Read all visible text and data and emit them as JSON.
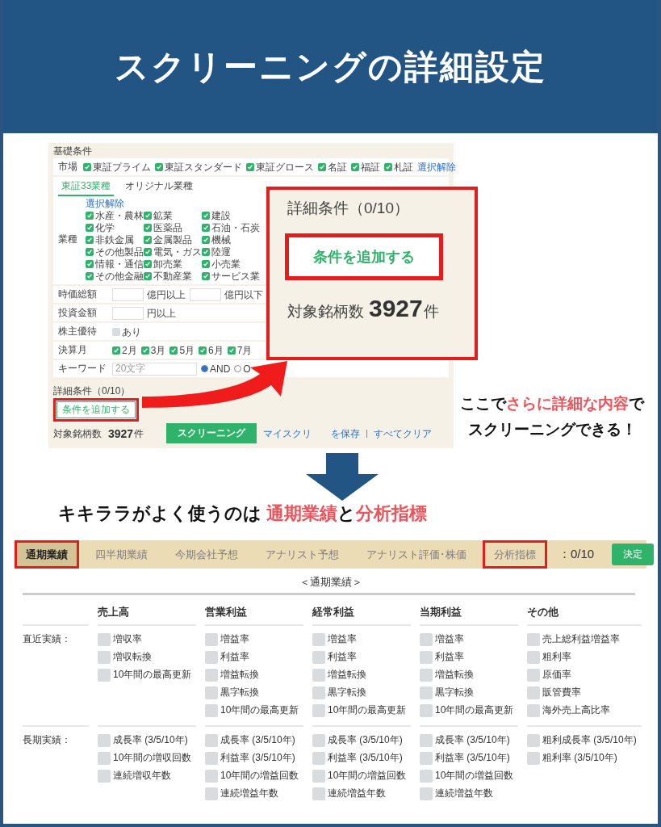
{
  "header": {
    "title": "スクリーニングの詳細設定"
  },
  "mini_screen": {
    "section_label": "基礎条件",
    "market": {
      "label": "市場",
      "options": [
        {
          "label": "東証プライム",
          "checked": true
        },
        {
          "label": "東証スタンダード",
          "checked": true
        },
        {
          "label": "東証グロース",
          "checked": true
        },
        {
          "label": "名証",
          "checked": true
        },
        {
          "label": "福証",
          "checked": true
        },
        {
          "label": "札証",
          "checked": true
        }
      ],
      "clear_link": "選択解除"
    },
    "industry_tabs": [
      {
        "label": "東証33業種",
        "selected": true
      },
      {
        "label": "オリジナル業種",
        "selected": false
      }
    ],
    "industry": {
      "label": "業種",
      "clear_link": "選択解除",
      "options": [
        {
          "label": "水産・農林",
          "checked": true
        },
        {
          "label": "鉱業",
          "checked": true
        },
        {
          "label": "建設",
          "checked": true
        },
        {
          "label": "化学",
          "checked": true
        },
        {
          "label": "医薬品",
          "checked": true
        },
        {
          "label": "石油・石炭",
          "checked": true
        },
        {
          "label": "非鉄金属",
          "checked": true
        },
        {
          "label": "金属製品",
          "checked": true
        },
        {
          "label": "機械",
          "checked": true
        },
        {
          "label": "その他製品",
          "checked": true
        },
        {
          "label": "電気・ガス",
          "checked": true
        },
        {
          "label": "陸運",
          "checked": true
        },
        {
          "label": "情報・通信",
          "checked": true
        },
        {
          "label": "卸売業",
          "checked": true
        },
        {
          "label": "小売業",
          "checked": true
        },
        {
          "label": "その他金融",
          "checked": true
        },
        {
          "label": "不動産業",
          "checked": true
        },
        {
          "label": "サービス業",
          "checked": true
        }
      ]
    },
    "fields": [
      {
        "kind": "range",
        "label": "時価総額",
        "units": [
          "億円以上",
          "億円以下"
        ]
      },
      {
        "kind": "range",
        "label": "投資金額",
        "units": [
          "円以上"
        ]
      },
      {
        "kind": "check",
        "label": "株主優待",
        "options": [
          {
            "label": "あり",
            "checked": false
          }
        ]
      },
      {
        "kind": "check",
        "label": "決算月",
        "options": [
          {
            "label": "2月",
            "checked": true
          },
          {
            "label": "3月",
            "checked": true
          },
          {
            "label": "5月",
            "checked": true
          },
          {
            "label": "6月",
            "checked": true
          },
          {
            "label": "7月",
            "checked": true
          }
        ]
      },
      {
        "kind": "keyword",
        "label": "キーワード",
        "placeholder": "20文字",
        "radios": [
          {
            "label": "AND",
            "selected": true
          },
          {
            "label": "O",
            "selected": false
          }
        ]
      }
    ],
    "detail_label": "詳細条件（0/10）",
    "add_button": {
      "label": "条件を追加する",
      "highlighted": true
    },
    "count": {
      "label": "対象銘柄数",
      "value": "3927",
      "unit": "件"
    },
    "screen_button": "スクリーニング",
    "links": [
      "マイスクリ",
      "を保存",
      "すべてクリア"
    ]
  },
  "callout": {
    "title": "詳細条件（0/10）",
    "button": {
      "label": "条件を追加する",
      "highlighted": true
    },
    "count_label": "対象銘柄数",
    "count": "3927",
    "unit": "件"
  },
  "note": [
    "ここで**さらに詳細な内容**で",
    "スクリーニングできる！"
  ],
  "caption": "キキララがよく使うのは **通期業績**と**分析指標**",
  "filter_tabs": [
    {
      "label": "通期業績",
      "selected": true,
      "highlighted": true
    },
    {
      "label": "四半期業績",
      "selected": false,
      "highlighted": false
    },
    {
      "label": "今期会社予想",
      "selected": false,
      "highlighted": false
    },
    {
      "label": "アナリスト予想",
      "selected": false,
      "highlighted": false
    },
    {
      "label": "アナリスト評価･株価",
      "selected": false,
      "highlighted": false
    },
    {
      "label": "分析指標",
      "selected": false,
      "highlighted": true
    }
  ],
  "filter_count": "：0/10",
  "confirm_button": "決定",
  "section_title": "＜通期業績＞",
  "columns": [
    "売上高",
    "営業利益",
    "経常利益",
    "当期利益",
    "その他"
  ],
  "rows": [
    {
      "label": "直近実績：",
      "cells": [
        [
          {
            "label": "増収率",
            "checked": false
          },
          {
            "label": "増収転換",
            "checked": false
          },
          {
            "label": "10年間の最高更新",
            "checked": false
          }
        ],
        [
          {
            "label": "増益率",
            "checked": false
          },
          {
            "label": "利益率",
            "checked": false
          },
          {
            "label": "増益転換",
            "checked": false
          },
          {
            "label": "黒字転換",
            "checked": false
          },
          {
            "label": "10年間の最高更新",
            "checked": false
          }
        ],
        [
          {
            "label": "増益率",
            "checked": false
          },
          {
            "label": "利益率",
            "checked": false
          },
          {
            "label": "増益転換",
            "checked": false
          },
          {
            "label": "黒字転換",
            "checked": false
          },
          {
            "label": "10年間の最高更新",
            "checked": false
          }
        ],
        [
          {
            "label": "増益率",
            "checked": false
          },
          {
            "label": "利益率",
            "checked": false
          },
          {
            "label": "増益転換",
            "checked": false
          },
          {
            "label": "黒字転換",
            "checked": false
          },
          {
            "label": "10年間の最高更新",
            "checked": false
          }
        ],
        [
          {
            "label": "売上総利益増益率",
            "checked": false
          },
          {
            "label": "粗利率",
            "checked": false
          },
          {
            "label": "原価率",
            "checked": false
          },
          {
            "label": "販管費率",
            "checked": false
          },
          {
            "label": "海外売上高比率",
            "checked": false
          }
        ]
      ]
    },
    {
      "label": "長期実績：",
      "cells": [
        [
          {
            "label": "成長率 (3/5/10年)",
            "checked": false
          },
          {
            "label": "10年間の増収回数",
            "checked": false
          },
          {
            "label": "連続増収年数",
            "checked": false
          }
        ],
        [
          {
            "label": "成長率 (3/5/10年)",
            "checked": false
          },
          {
            "label": "利益率 (3/5/10年)",
            "checked": false
          },
          {
            "label": "10年間の増益回数",
            "checked": false
          },
          {
            "label": "連続増益年数",
            "checked": false
          }
        ],
        [
          {
            "label": "成長率 (3/5/10年)",
            "checked": false
          },
          {
            "label": "利益率 (3/5/10年)",
            "checked": false
          },
          {
            "label": "10年間の増益回数",
            "checked": false
          },
          {
            "label": "連続増益年数",
            "checked": false
          }
        ],
        [
          {
            "label": "成長率 (3/5/10年)",
            "checked": false
          },
          {
            "label": "利益率 (3/5/10年)",
            "checked": false
          },
          {
            "label": "10年間の増益回数",
            "checked": false
          },
          {
            "label": "連続増益年数",
            "checked": false
          }
        ],
        [
          {
            "label": "粗利成長率 (3/5/10年)",
            "checked": false
          },
          {
            "label": "粗利率 (3/5/10年)",
            "checked": false
          }
        ]
      ]
    }
  ]
}
